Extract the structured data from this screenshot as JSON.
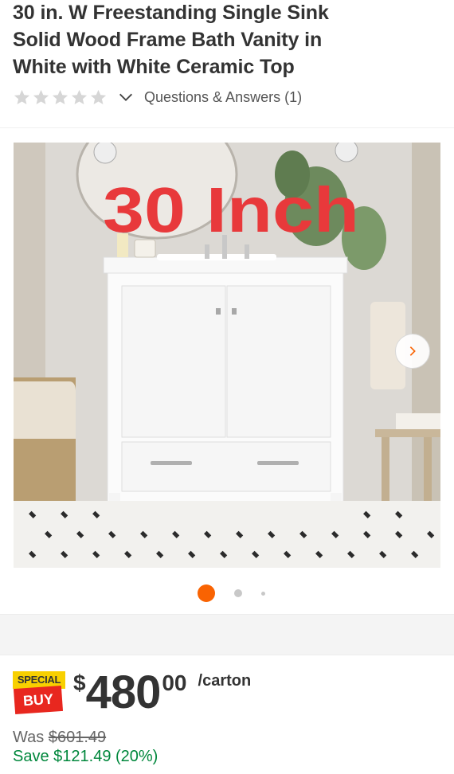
{
  "product": {
    "title_line1": "30 in. W Freestanding Single Sink",
    "title_line2": "Solid Wood Frame Bath Vanity in",
    "title_line3": "White with White Ceramic Top",
    "rating_stars": 0,
    "rating_max": 5,
    "qa_link": "Questions & Answers (1)"
  },
  "gallery": {
    "overlay_text": "30 Inch",
    "image_count": 3,
    "active_index": 0
  },
  "pricing": {
    "badge_top": "SPECIAL",
    "badge_bottom": "BUY",
    "currency": "$",
    "dollars": "480",
    "cents": "00",
    "unit": "/carton",
    "was_label": "Was",
    "was_price": "$601.49",
    "save_text": "Save $121.49 (20%)"
  },
  "colors": {
    "accent": "#f96302",
    "sale_green": "#00873c",
    "badge_yellow": "#f8d000",
    "badge_red": "#e8271f"
  },
  "icons": {
    "rating": "star-icon",
    "expand": "chevron-down-icon",
    "next": "chevron-right-icon"
  }
}
